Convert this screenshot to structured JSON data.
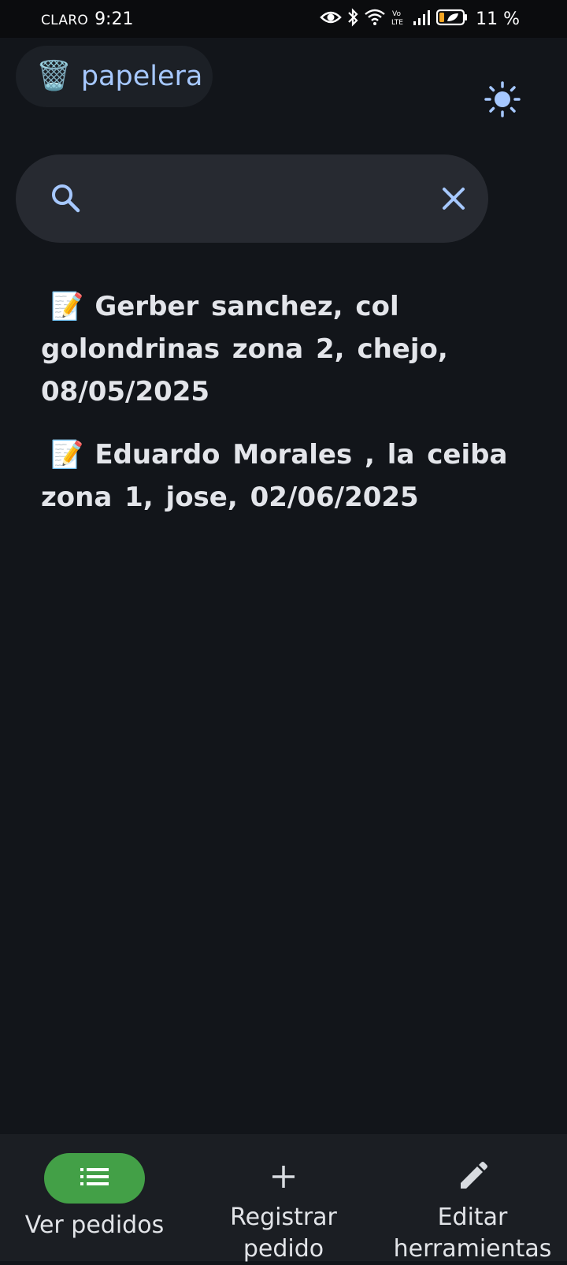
{
  "status_bar": {
    "carrier": "CLARO",
    "time": "9:21",
    "battery_percent": "11 %",
    "icons": [
      "eye-icon",
      "bluetooth-icon",
      "wifi-icon",
      "volte-icon",
      "signal-icon",
      "battery-icon"
    ]
  },
  "header": {
    "trash_emoji": "🗑️",
    "trash_label": "papelera",
    "theme_icon": "sun-icon"
  },
  "search": {
    "value": "",
    "placeholder": "",
    "search_icon": "search-icon",
    "clear_icon": "close-icon"
  },
  "orders": [
    {
      "emoji": "📝",
      "text": "Gerber sanchez,  col golondrinas zona 2,  chejo,  08/05/2025"
    },
    {
      "emoji": "📝",
      "text": "Eduardo Morales ,  la ceiba zona 1,  jose,  02/06/2025"
    }
  ],
  "bottom_nav": {
    "items": [
      {
        "label": "Ver pedidos",
        "icon": "list-icon",
        "active": true
      },
      {
        "label": "Registrar pedido",
        "icon": "plus-icon",
        "active": false
      },
      {
        "label": "Editar herramientas",
        "icon": "pencil-icon",
        "active": false
      }
    ]
  },
  "colors": {
    "background": "#12151a",
    "accent_blue": "#a6c8ff",
    "active_nav": "#43a047",
    "nav_background": "#1b1e23",
    "search_background": "#272a31"
  }
}
